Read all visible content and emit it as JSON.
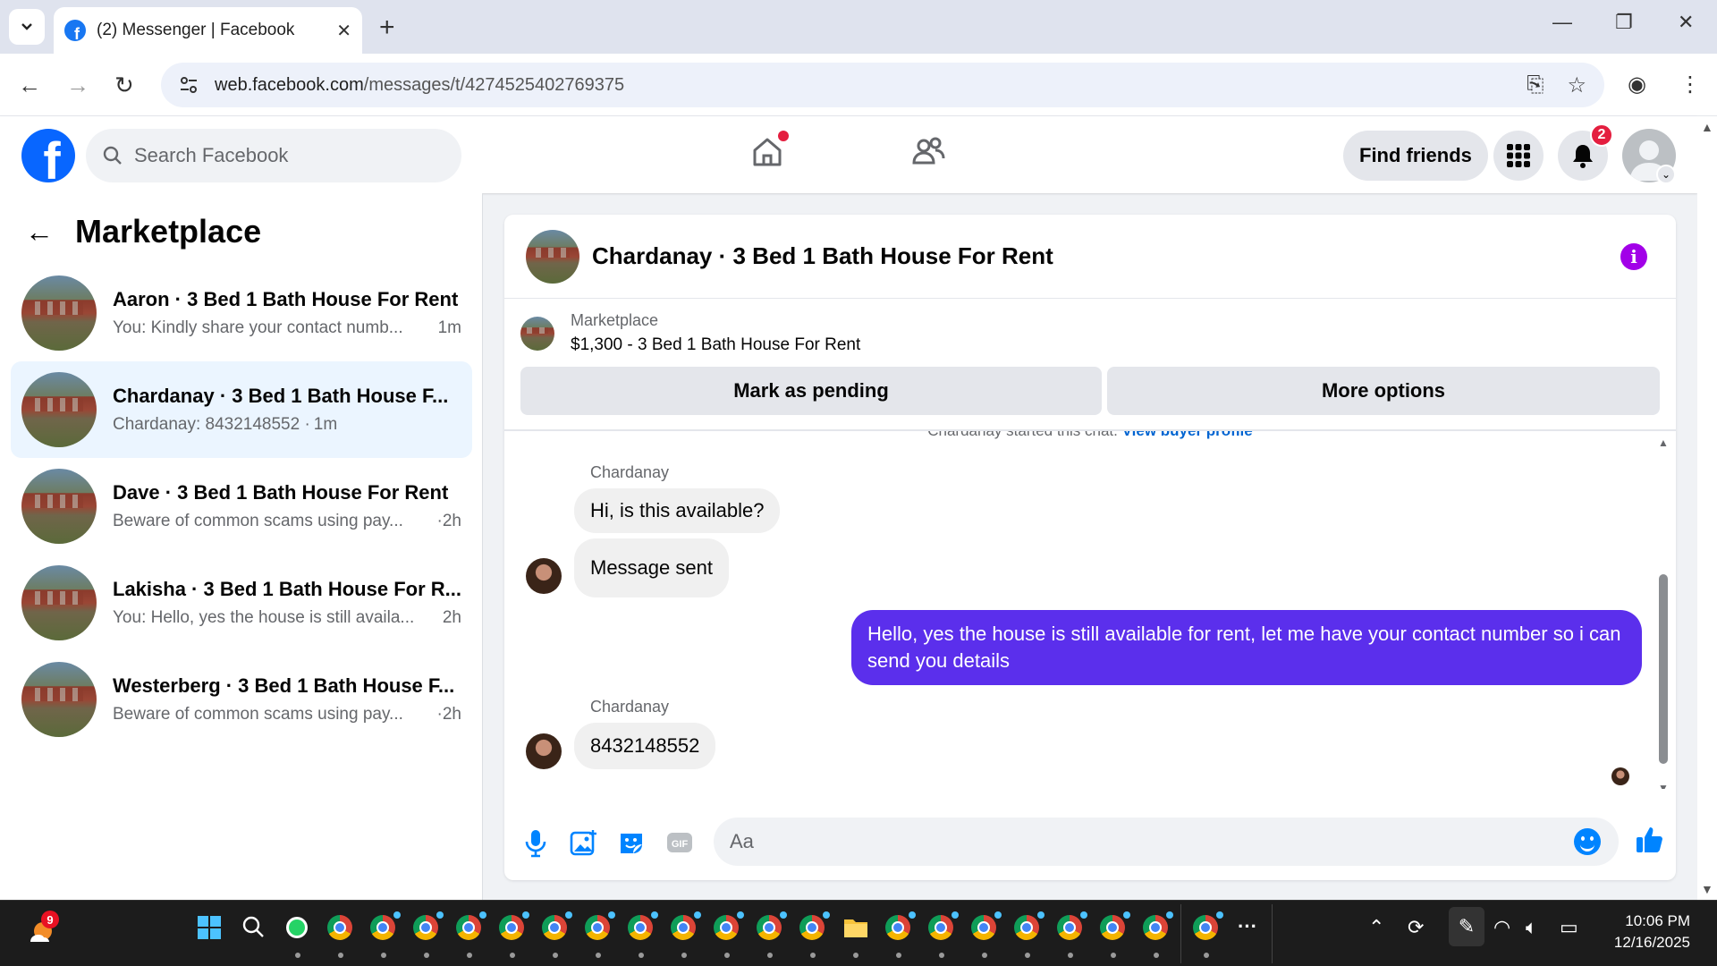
{
  "browser": {
    "tab_title": "(2) Messenger | Facebook",
    "url_host": "web.facebook.com",
    "url_path": "/messages/t/4274525402769375"
  },
  "fbnav": {
    "search_placeholder": "Search Facebook",
    "find_friends": "Find friends",
    "notification_count": "2"
  },
  "sidebar": {
    "title": "Marketplace",
    "conversations": [
      {
        "title": "Aaron · 3 Bed 1 Bath House For Rent",
        "preview": "You: Kindly share your contact numb...",
        "time": "1m"
      },
      {
        "title": "Chardanay · 3 Bed 1 Bath House F...",
        "preview": "Chardanay: 8432148552 ·",
        "time": "1m"
      },
      {
        "title": "Dave · 3 Bed 1 Bath House For Rent",
        "preview": "Beware of common scams using pay...",
        "time": "·2h"
      },
      {
        "title": "Lakisha · 3 Bed 1 Bath House For R...",
        "preview": "You: Hello, yes the house is still availa...",
        "time": "2h"
      },
      {
        "title": "Westerberg · 3 Bed 1 Bath House F...",
        "preview": "Beware of common scams using pay...",
        "time": "·2h"
      }
    ]
  },
  "chat": {
    "title": "Chardanay · 3 Bed 1 Bath House For Rent",
    "marketplace_label": "Marketplace",
    "listing": "$1,300 - 3 Bed 1 Bath House For Rent",
    "mark_pending": "Mark as pending",
    "more_options": "More options",
    "started_text": "Chardanay started this chat.",
    "view_profile": "View buyer profile",
    "messages": [
      {
        "sender": "Chardanay",
        "text": "Hi, is this available?"
      },
      {
        "text": "Message sent"
      },
      {
        "text": "Hello, yes the house is still available for rent, let me have your contact number so i can send you  details"
      },
      {
        "sender": "Chardanay",
        "text": "8432148552"
      }
    ],
    "composer_placeholder": "Aa"
  },
  "taskbar": {
    "weather_badge": "9",
    "time": "10:06 PM",
    "date": "12/16/2025"
  },
  "colors": {
    "fb_blue": "#0866ff",
    "outgoing_bubble": "#5b2fec",
    "active_conversation": "#ebf5ff",
    "notification_red": "#e41e3f",
    "info_purple": "#a200e8"
  }
}
